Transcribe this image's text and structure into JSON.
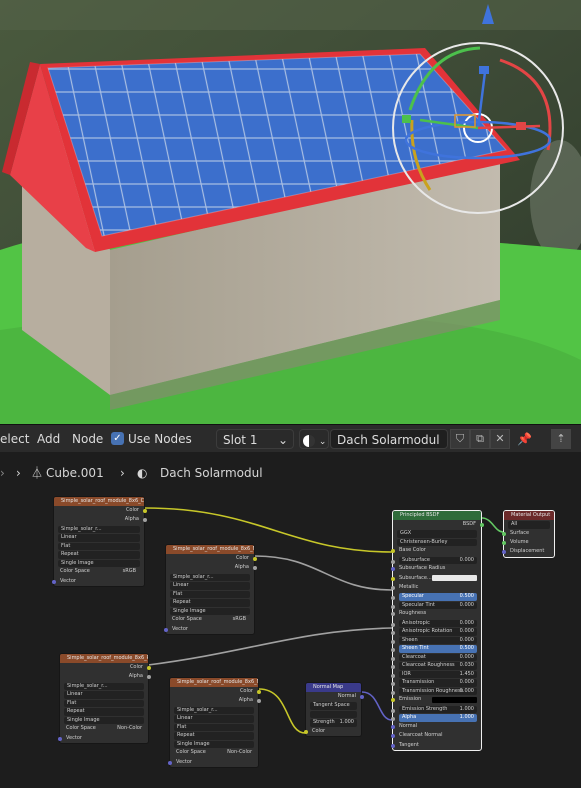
{
  "header": {
    "menu_select": "elect",
    "menu_add": "Add",
    "menu_node": "Node",
    "use_nodes_label": "Use Nodes",
    "slot": "Slot 1",
    "material_name": "Dach Solarmodul"
  },
  "breadcrumb": {
    "object": "Cube.001",
    "material": "Dach Solarmodul"
  },
  "nodes": {
    "tex1": {
      "title": "Simple_solar_roof_module_8x6_Col",
      "out_color": "Color",
      "out_alpha": "Alpha",
      "image": "Simple_solar_r...",
      "interp": "Linear",
      "proj": "Flat",
      "ext": "Repeat",
      "src": "Single Image",
      "cs_label": "Color Space",
      "cs": "sRGB",
      "in_vector": "Vector"
    },
    "tex2": {
      "title": "Simple_solar_roof_module_8x6_Met",
      "out_color": "Color",
      "out_alpha": "Alpha",
      "image": "Simple_solar_r...",
      "interp": "Linear",
      "proj": "Flat",
      "ext": "Repeat",
      "src": "Single Image",
      "cs_label": "Color Space",
      "cs": "sRGB",
      "in_vector": "Vector"
    },
    "tex3": {
      "title": "Simple_solar_roof_module_8x6_Ro",
      "out_color": "Color",
      "out_alpha": "Alpha",
      "image": "Simple_solar_r...",
      "interp": "Linear",
      "proj": "Flat",
      "ext": "Repeat",
      "src": "Single Image",
      "cs_label": "Color Space",
      "cs": "Non-Color",
      "in_vector": "Vector"
    },
    "tex4": {
      "title": "Simple_solar_roof_module_8x6_No",
      "out_color": "Color",
      "out_alpha": "Alpha",
      "image": "Simple_solar_r...",
      "interp": "Linear",
      "proj": "Flat",
      "ext": "Repeat",
      "src": "Single Image",
      "cs_label": "Color Space",
      "cs": "Non-Color",
      "in_vector": "Vector"
    },
    "normalmap": {
      "title": "Normal Map",
      "out_normal": "Normal",
      "space": "Tangent Space",
      "uv": "",
      "strength_label": "Strength",
      "strength": "1.000",
      "in_color": "Color"
    },
    "bsdf": {
      "title": "Principled BSDF",
      "out_bsdf": "BSDF",
      "dist": "GGX",
      "sss": "Christensen-Burley",
      "rows": [
        {
          "label": "Base Color",
          "value": ""
        },
        {
          "label": "Subsurface",
          "value": "0.000"
        },
        {
          "label": "Subsurface Radius",
          "value": ""
        },
        {
          "label": "Subsurface...",
          "value": ""
        },
        {
          "label": "Metallic",
          "value": ""
        },
        {
          "label": "Specular",
          "value": "0.500"
        },
        {
          "label": "Specular Tint",
          "value": "0.000"
        },
        {
          "label": "Roughness",
          "value": ""
        },
        {
          "label": "Anisotropic",
          "value": "0.000"
        },
        {
          "label": "Anisotropic Rotation",
          "value": "0.000"
        },
        {
          "label": "Sheen",
          "value": "0.000"
        },
        {
          "label": "Sheen Tint",
          "value": "0.500"
        },
        {
          "label": "Clearcoat",
          "value": "0.000"
        },
        {
          "label": "Clearcoat Roughness",
          "value": "0.030"
        },
        {
          "label": "IOR",
          "value": "1.450"
        },
        {
          "label": "Transmission",
          "value": "0.000"
        },
        {
          "label": "Transmission Roughness",
          "value": "0.000"
        },
        {
          "label": "Emission",
          "value": ""
        },
        {
          "label": "Emission Strength",
          "value": "1.000"
        },
        {
          "label": "Alpha",
          "value": "1.000"
        },
        {
          "label": "Normal",
          "value": ""
        },
        {
          "label": "Clearcoat Normal",
          "value": ""
        },
        {
          "label": "Tangent",
          "value": ""
        }
      ]
    },
    "output": {
      "title": "Material Output",
      "target": "All",
      "in_surface": "Surface",
      "in_volume": "Volume",
      "in_displacement": "Displacement"
    }
  },
  "colors": {
    "accent": "#4772b3",
    "roof_red": "#e8353b",
    "panel_blue": "#3a6fc9",
    "grass": "#55c94a",
    "texture_header": "#8a4a2a",
    "shader_header": "#2f6b3a",
    "vector_header": "#3a3a8a",
    "output_header": "#6b2a2a"
  }
}
